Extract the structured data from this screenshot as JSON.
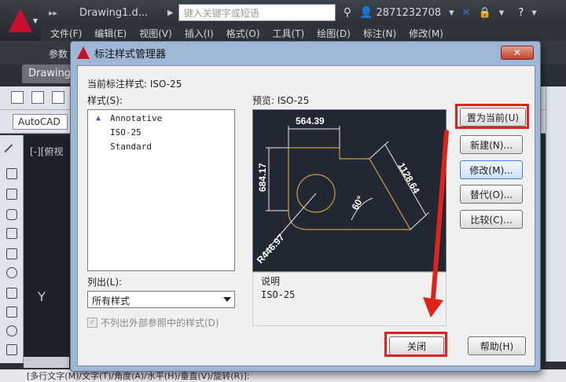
{
  "app": {
    "title": "Drawing1.d...",
    "search_placeholder": "键入关键字或短语",
    "user_id": "2871232708",
    "doc_tab": "Drawing",
    "workspace": "AutoCAD",
    "viewport_label": "[-][俯视",
    "y_axis": "Y",
    "ribbon_label": "参数",
    "command_line": "[多行文字(M)/文字(T)/角度(A)/水平(H)/垂直(V)/旋转(R)]:"
  },
  "menu": [
    "文件(F)",
    "编辑(E)",
    "视图(V)",
    "插入(I)",
    "格式(O)",
    "工具(T)",
    "绘图(D)",
    "标注(N)",
    "修改(M)"
  ],
  "dialog": {
    "title": "标注样式管理器",
    "close_label": "✕",
    "current_style": "当前标注样式: ISO-25",
    "styles_label": "样式(S):",
    "styles": [
      "Annotative",
      "ISO-25",
      "Standard"
    ],
    "list_label": "列出(L):",
    "list_value": "所有样式",
    "xref_label": "不列出外部参照中的样式(D)",
    "preview_label": "预览: ISO-25",
    "desc_label": "说明",
    "desc_value": "ISO-25",
    "buttons": {
      "set_current": "置为当前(U)",
      "new": "新建(N)...",
      "modify": "修改(M)...",
      "override": "替代(O)...",
      "compare": "比较(C)...",
      "close": "关闭",
      "help": "帮助(H)"
    },
    "preview_dims": {
      "d1": "564.39",
      "d2": "684.17",
      "d3": "1128.64",
      "d4": "60°",
      "d5": "R446.97"
    }
  },
  "colors": {
    "highlight": "#e0221a",
    "preview_bg": "#212833",
    "preview_line": "#c8a040"
  }
}
